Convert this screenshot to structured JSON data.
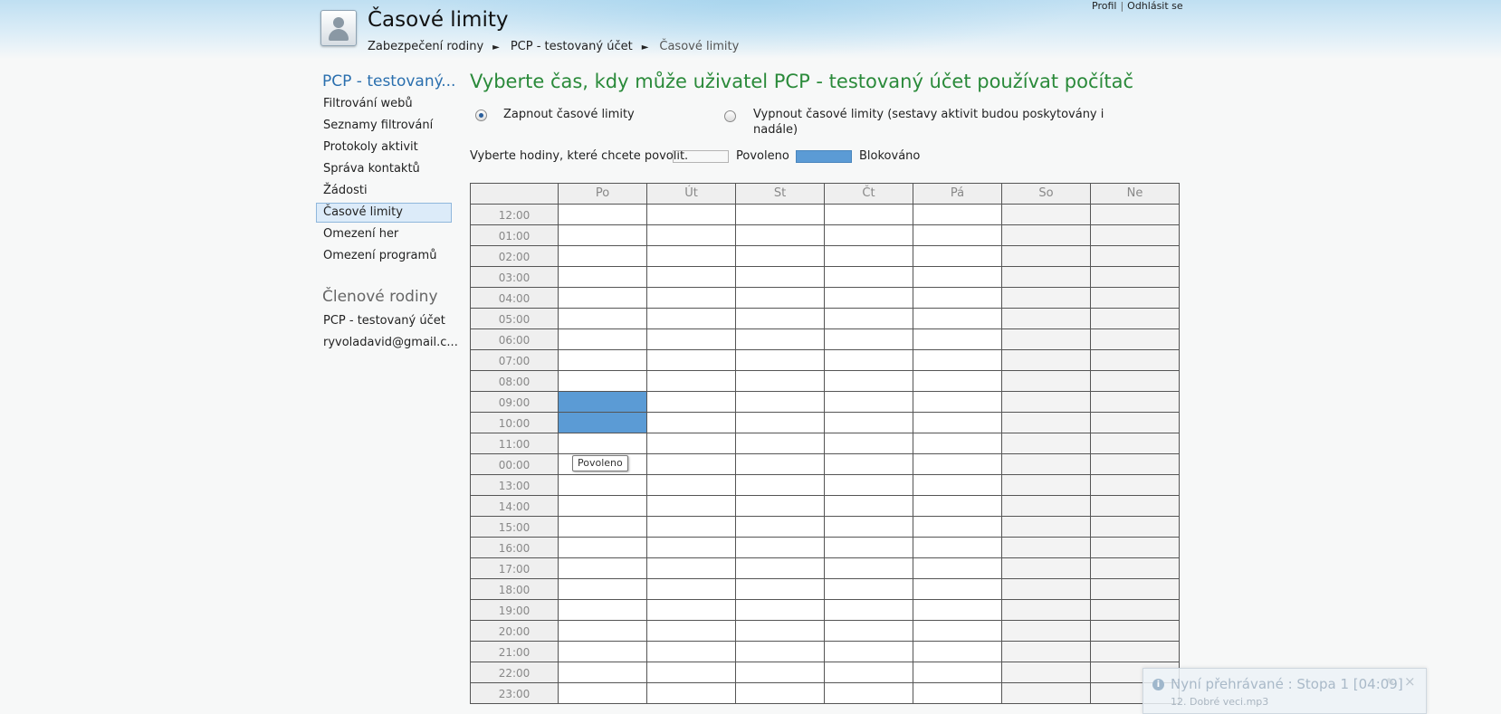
{
  "header": {
    "title": "Časové limity",
    "breadcrumb": [
      "Zabezpečení rodiny",
      "PCP - testovaný účet",
      "Časové limity"
    ],
    "breadcrumb_sep": "►",
    "profile_link": "Profil",
    "divider": "|",
    "logout_link": "Odhlásit se"
  },
  "sidebar": {
    "account_heading": "PCP - testovaný...",
    "items": [
      {
        "label": "Filtrování webů"
      },
      {
        "label": "Seznamy filtrování"
      },
      {
        "label": "Protokoly aktivit"
      },
      {
        "label": "Správa kontaktů"
      },
      {
        "label": "Žádosti"
      },
      {
        "label": "Časové limity",
        "active": true
      },
      {
        "label": "Omezení her"
      },
      {
        "label": "Omezení programů"
      }
    ],
    "members_heading": "Členové rodiny",
    "members": [
      {
        "label": "PCP - testovaný účet"
      },
      {
        "label": "ryvoladavid@gmail.c..."
      }
    ]
  },
  "main": {
    "title": "Vyberte čas, kdy může uživatel PCP - testovaný účet používat počítač",
    "radio_on": "Zapnout časové limity",
    "radio_off_line1": "Vypnout časové limity (sestavy aktivit budou poskytovány i",
    "radio_off_line2": "nadále)",
    "selected": "on",
    "legend_text": "Vyberte hodiny, které chcete povolit.",
    "legend_allowed": "Povoleno",
    "legend_blocked": "Blokováno",
    "colors": {
      "allowed": "#ffffff",
      "blocked": "#5b9bd5",
      "title_green": "#2a8a3a",
      "link_blue": "#2a6fae"
    }
  },
  "schedule": {
    "days": [
      "Po",
      "Út",
      "St",
      "Čt",
      "Pá",
      "So",
      "Ne"
    ],
    "weekend_shaded": [
      "So",
      "Ne"
    ],
    "hours": [
      "12:00",
      "01:00",
      "02:00",
      "03:00",
      "04:00",
      "05:00",
      "06:00",
      "07:00",
      "08:00",
      "09:00",
      "10:00",
      "11:00",
      "00:00",
      "13:00",
      "14:00",
      "15:00",
      "16:00",
      "17:00",
      "18:00",
      "19:00",
      "20:00",
      "21:00",
      "22:00",
      "23:00"
    ],
    "blocked": [
      {
        "day": "Po",
        "hour": "09:00"
      },
      {
        "day": "Po",
        "hour": "10:00"
      }
    ],
    "tooltip": "Povoleno"
  },
  "notification": {
    "icon": "info-icon",
    "title": "Nyní přehrávané : Stopa 1 [04:09]",
    "subtitle": "12. Dobré veci.mp3"
  }
}
